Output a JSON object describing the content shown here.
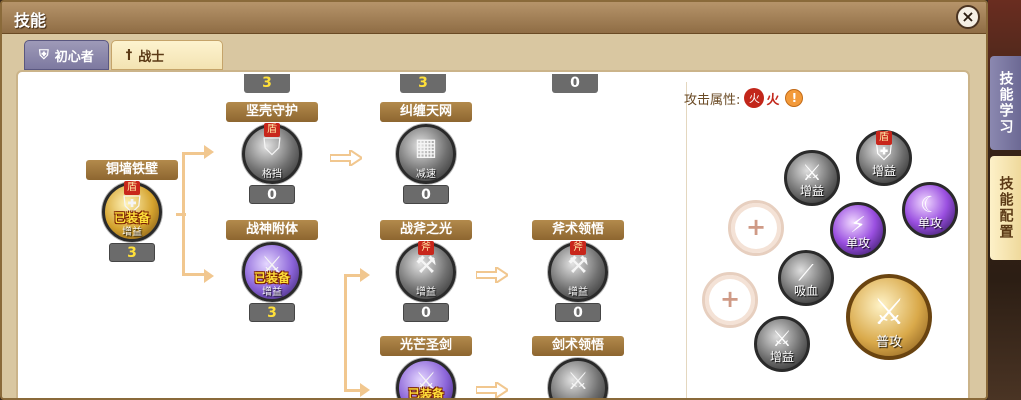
{
  "window": {
    "title": "技能",
    "close_label": "×"
  },
  "tabs": [
    {
      "label": "初心者",
      "icon": "shield-icon"
    },
    {
      "label": "战士",
      "icon": "sword-icon"
    }
  ],
  "side_tabs": [
    {
      "label": "技能学习"
    },
    {
      "label": "技能配置"
    }
  ],
  "tree": {
    "top_levels": [
      "3",
      "3",
      "0"
    ],
    "skills": [
      {
        "id": "tongqiang",
        "name": "铜墙铁壁",
        "badge": "盾",
        "equipped": "已装备",
        "type": "增益",
        "level": "3"
      },
      {
        "id": "jianke",
        "name": "坚壳守护",
        "badge": "盾",
        "equipped": "",
        "type": "格挡",
        "level": "0"
      },
      {
        "id": "zhanshen",
        "name": "战神附体",
        "badge": "",
        "equipped": "已装备",
        "type": "增益",
        "level": "3"
      },
      {
        "id": "jiuchan",
        "name": "纠缠天网",
        "badge": "",
        "equipped": "",
        "type": "减速",
        "level": "0"
      },
      {
        "id": "zhanfu",
        "name": "战斧之光",
        "badge": "斧",
        "equipped": "",
        "type": "增益",
        "level": "0"
      },
      {
        "id": "fushu",
        "name": "斧术领悟",
        "badge": "斧",
        "equipped": "",
        "type": "增益",
        "level": "0"
      },
      {
        "id": "guangmang",
        "name": "光芒圣剑",
        "badge": "",
        "equipped": "已装备",
        "type": "",
        "level": ""
      },
      {
        "id": "jianshu",
        "name": "剑术领悟",
        "badge": "",
        "equipped": "",
        "type": "",
        "level": ""
      }
    ]
  },
  "config": {
    "attack_attr_label": "攻击属性:",
    "fire_glyph": "火",
    "fire_label": "火",
    "info_glyph": "!",
    "plus_glyph": "+",
    "slots": [
      {
        "label": "增益",
        "badge": ""
      },
      {
        "label": "增益",
        "badge": "盾"
      },
      {
        "label": "单攻",
        "badge": ""
      },
      {
        "label": "单攻",
        "badge": ""
      },
      {
        "label": "吸血",
        "badge": ""
      },
      {
        "label": "增益",
        "badge": ""
      },
      {
        "label": "普攻",
        "badge": ""
      }
    ]
  },
  "colors": {
    "accent": "#8d6630",
    "fire": "#c2261a",
    "equipped": "#ffe03a"
  }
}
